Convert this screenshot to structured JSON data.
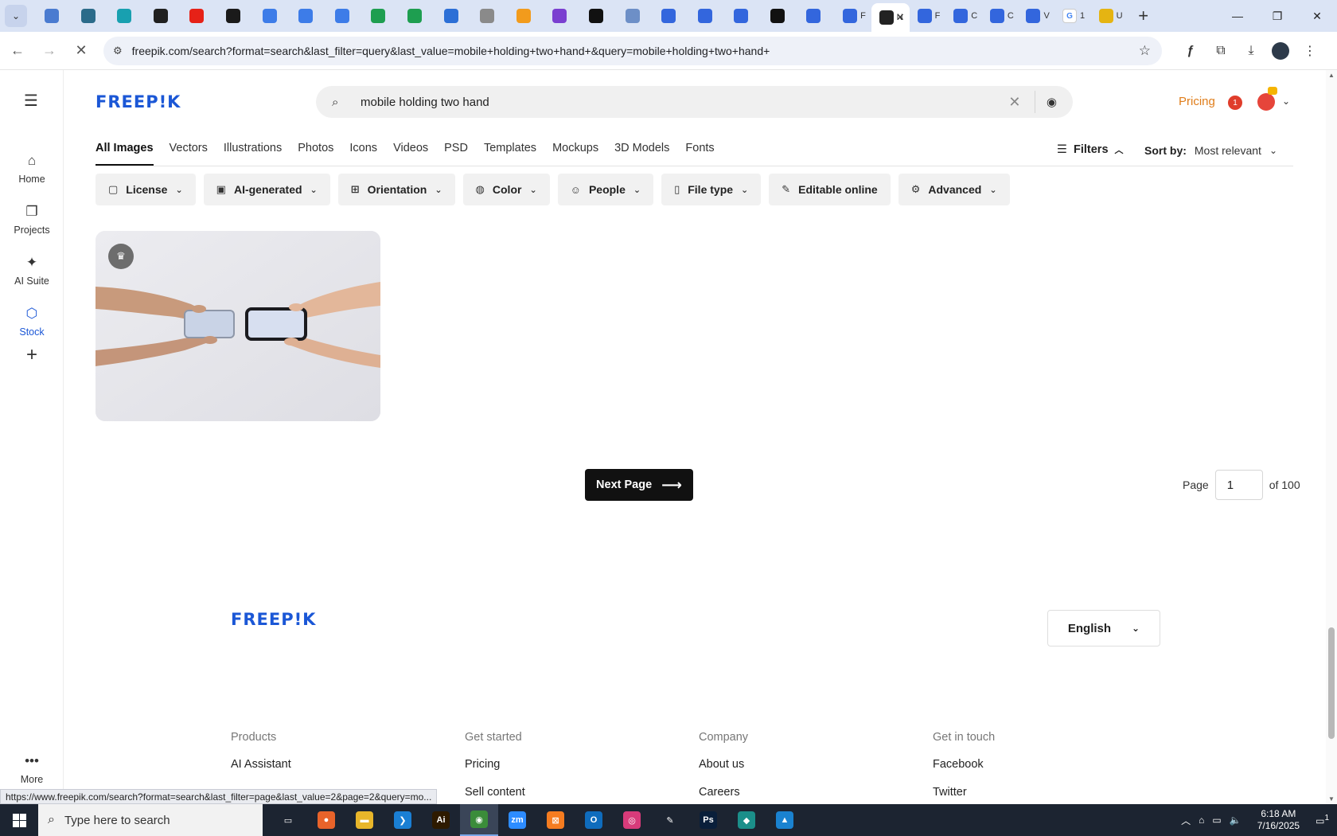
{
  "browser": {
    "tabs": [
      {
        "icon": "globe",
        "color": "#4a7bd0"
      },
      {
        "icon": "v",
        "color": "#2b6b8a"
      },
      {
        "icon": "play",
        "color": "#18a0b0"
      },
      {
        "icon": "chatgpt",
        "color": "#202020"
      },
      {
        "icon": "youtube",
        "color": "#e62117"
      },
      {
        "icon": "bolt",
        "color": "#1a1a1a"
      },
      {
        "icon": "docs",
        "color": "#3d7ce8"
      },
      {
        "icon": "docs",
        "color": "#3d7ce8"
      },
      {
        "icon": "docs",
        "color": "#3d7ce8"
      },
      {
        "icon": "sheets",
        "color": "#1e9e50"
      },
      {
        "icon": "sheets",
        "color": "#1e9e50"
      },
      {
        "icon": "word",
        "color": "#2c6fd6"
      },
      {
        "icon": "globe-gray",
        "color": "#8a8a8a"
      },
      {
        "icon": "v-orange",
        "color": "#f29b1c"
      },
      {
        "icon": "braces",
        "color": "#7a3fd0"
      },
      {
        "icon": "a",
        "color": "#111111"
      },
      {
        "icon": "grid",
        "color": "#6d8fc7"
      },
      {
        "icon": "forms",
        "color": "#3366dd"
      },
      {
        "icon": "forms",
        "color": "#3366dd"
      },
      {
        "icon": "forms",
        "color": "#3366dd"
      },
      {
        "icon": "m",
        "color": "#111111"
      },
      {
        "icon": "forms",
        "color": "#3366dd"
      },
      {
        "icon": "forms",
        "color": "#3366dd",
        "title": "F"
      },
      {
        "icon": "notion",
        "color": "#222222",
        "title": "N",
        "active": true
      },
      {
        "icon": "forms",
        "color": "#3366dd",
        "title": "F"
      },
      {
        "icon": "forms",
        "color": "#3366dd",
        "title": "C"
      },
      {
        "icon": "forms",
        "color": "#3366dd",
        "title": "C"
      },
      {
        "icon": "forms",
        "color": "#3366dd",
        "title": "V"
      },
      {
        "icon": "google",
        "color": "#ffffff",
        "title": "1"
      },
      {
        "icon": "hat",
        "color": "#e5b412",
        "title": "U"
      }
    ],
    "url": "freepik.com/search?format=search&last_filter=query&last_value=mobile+holding+two+hand+&query=mobile+holding+two+hand+",
    "status_url": "https://www.freepik.com/search?format=search&last_filter=page&last_value=2&page=2&query=mo..."
  },
  "rail": {
    "items": [
      {
        "label": "Home",
        "icon": "home-icon"
      },
      {
        "label": "Projects",
        "icon": "projects-icon"
      },
      {
        "label": "AI Suite",
        "icon": "sparkle-icon"
      },
      {
        "label": "Stock",
        "icon": "stock-icon"
      }
    ],
    "more_label": "More"
  },
  "header": {
    "logo": "FREEP!K",
    "search_value": "mobile holding two hand",
    "pricing_label": "Pricing",
    "notification_count": "1"
  },
  "categories": [
    "All Images",
    "Vectors",
    "Illustrations",
    "Photos",
    "Icons",
    "Videos",
    "PSD",
    "Templates",
    "Mockups",
    "3D Models",
    "Fonts"
  ],
  "filters": {
    "filters_label": "Filters",
    "sort_label": "Sort by:",
    "sort_value": "Most relevant",
    "chips": [
      {
        "label": "License",
        "icon": "license-icon",
        "dropdown": true
      },
      {
        "label": "AI-generated",
        "icon": "ai-icon",
        "dropdown": true
      },
      {
        "label": "Orientation",
        "icon": "orientation-icon",
        "dropdown": true
      },
      {
        "label": "Color",
        "icon": "palette-icon",
        "dropdown": true
      },
      {
        "label": "People",
        "icon": "people-icon",
        "dropdown": true
      },
      {
        "label": "File type",
        "icon": "file-icon",
        "dropdown": true
      },
      {
        "label": "Editable online",
        "icon": "pencil-icon",
        "dropdown": false
      },
      {
        "label": "Advanced",
        "icon": "gear-icon",
        "dropdown": true
      }
    ]
  },
  "pagination": {
    "next_label": "Next Page",
    "page_label": "Page",
    "page_value": "1",
    "of_label": "of 100"
  },
  "footer": {
    "logo": "FREEP!K",
    "language": "English",
    "columns": [
      {
        "heading": "Products",
        "links": [
          "AI Assistant"
        ]
      },
      {
        "heading": "Get started",
        "links": [
          "Pricing",
          "Sell content"
        ]
      },
      {
        "heading": "Company",
        "links": [
          "About us",
          "Careers"
        ]
      },
      {
        "heading": "Get in touch",
        "links": [
          "Facebook",
          "Twitter"
        ]
      }
    ]
  },
  "taskbar": {
    "search_placeholder": "Type here to search",
    "time": "6:18 AM",
    "date": "7/16/2025",
    "notification_count": "1",
    "apps": [
      {
        "name": "task-view",
        "color": "#1c2431",
        "glyph": "▭"
      },
      {
        "name": "firefox",
        "color": "#e8632a",
        "glyph": "●"
      },
      {
        "name": "file-explorer",
        "color": "#e8b62a",
        "glyph": "▬"
      },
      {
        "name": "vscode",
        "color": "#1a7fd4",
        "glyph": "❯"
      },
      {
        "name": "illustrator",
        "color": "#2e1a00",
        "glyph": "Ai"
      },
      {
        "name": "chrome",
        "color": "#3b8c3a",
        "glyph": "◉",
        "active": true
      },
      {
        "name": "zoom",
        "color": "#2d8cff",
        "glyph": "zm"
      },
      {
        "name": "xampp",
        "color": "#f57c20",
        "glyph": "⊠"
      },
      {
        "name": "outlook",
        "color": "#0f6cbd",
        "glyph": "O"
      },
      {
        "name": "creative-cloud",
        "color": "#d83b7a",
        "glyph": "◎"
      },
      {
        "name": "pen-tool",
        "color": "#1c2431",
        "glyph": "✎"
      },
      {
        "name": "photoshop",
        "color": "#0a1f3a",
        "glyph": "Ps"
      },
      {
        "name": "app-diamond",
        "color": "#1b8f8a",
        "glyph": "◆"
      },
      {
        "name": "photos",
        "color": "#1a82d0",
        "glyph": "▲"
      }
    ]
  }
}
